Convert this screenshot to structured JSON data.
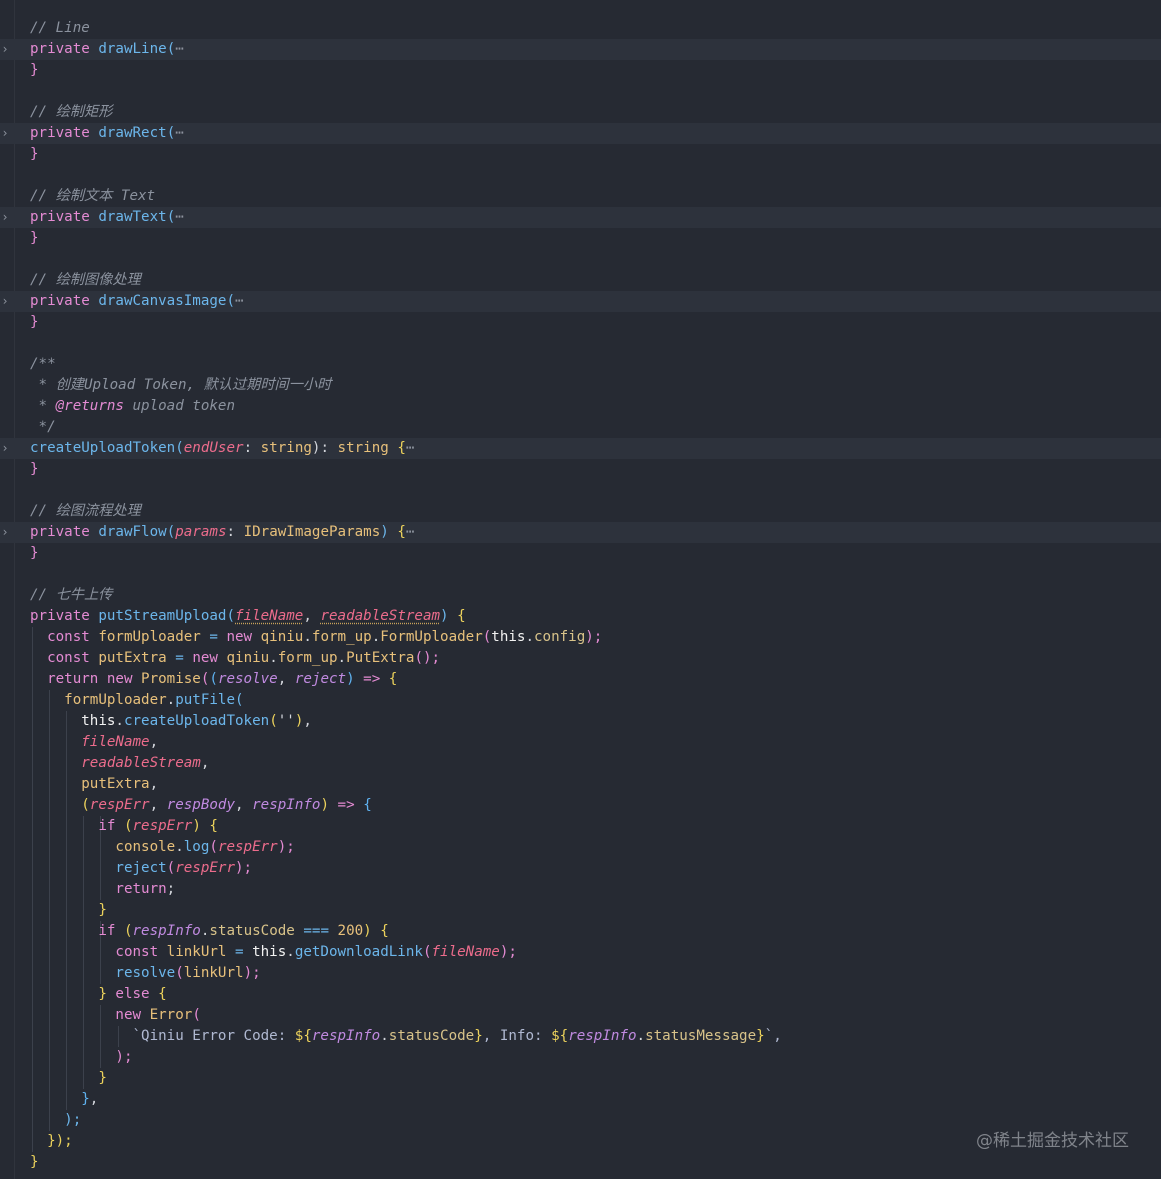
{
  "watermark": "@稀土掘金技术社区",
  "icons": {
    "fold": "chevron-right-icon",
    "ellipsis": "folded-ellipsis-icon"
  },
  "colors": {
    "background": "#262a33",
    "folded_line": "#2d323c",
    "comment": "#8b929e",
    "keyword": "#e48bd3",
    "function": "#6cb6eb",
    "parameter": "#ec6c8c",
    "type": "#e7c07b"
  },
  "code_lines": [
    {
      "folded": false,
      "tokens": [
        {
          "t": "// Line",
          "c": "cm"
        }
      ]
    },
    {
      "folded": true,
      "tokens": [
        {
          "t": "private ",
          "c": "kw"
        },
        {
          "t": "drawLine",
          "c": "fn"
        },
        {
          "t": "(",
          "c": "fn"
        },
        {
          "t": "⋯",
          "c": "ellipsis"
        }
      ]
    },
    {
      "folded": false,
      "tokens": [
        {
          "t": "}",
          "c": "b2"
        }
      ]
    },
    {
      "folded": false,
      "tokens": []
    },
    {
      "folded": false,
      "tokens": [
        {
          "t": "// 绘制矩形",
          "c": "cm"
        }
      ]
    },
    {
      "folded": true,
      "tokens": [
        {
          "t": "private ",
          "c": "kw"
        },
        {
          "t": "drawRect",
          "c": "fn"
        },
        {
          "t": "(",
          "c": "fn"
        },
        {
          "t": "⋯",
          "c": "ellipsis"
        }
      ]
    },
    {
      "folded": false,
      "tokens": [
        {
          "t": "}",
          "c": "b2"
        }
      ]
    },
    {
      "folded": false,
      "tokens": []
    },
    {
      "folded": false,
      "tokens": [
        {
          "t": "// 绘制文本 Text",
          "c": "cm"
        }
      ]
    },
    {
      "folded": true,
      "tokens": [
        {
          "t": "private ",
          "c": "kw"
        },
        {
          "t": "drawText",
          "c": "fn"
        },
        {
          "t": "(",
          "c": "fn"
        },
        {
          "t": "⋯",
          "c": "ellipsis"
        }
      ]
    },
    {
      "folded": false,
      "tokens": [
        {
          "t": "}",
          "c": "b2"
        }
      ]
    },
    {
      "folded": false,
      "tokens": []
    },
    {
      "folded": false,
      "tokens": [
        {
          "t": "// 绘制图像处理",
          "c": "cm"
        }
      ]
    },
    {
      "folded": true,
      "tokens": [
        {
          "t": "private ",
          "c": "kw"
        },
        {
          "t": "drawCanvasImage",
          "c": "fn"
        },
        {
          "t": "(",
          "c": "fn"
        },
        {
          "t": "⋯",
          "c": "ellipsis"
        }
      ]
    },
    {
      "folded": false,
      "tokens": [
        {
          "t": "}",
          "c": "b2"
        }
      ]
    },
    {
      "folded": false,
      "tokens": []
    },
    {
      "folded": false,
      "tokens": [
        {
          "t": "/**",
          "c": "cm"
        }
      ]
    },
    {
      "folded": false,
      "tokens": [
        {
          "t": " * 创建Upload Token, 默认过期时间一小时",
          "c": "cm"
        }
      ]
    },
    {
      "folded": false,
      "tokens": [
        {
          "t": " * ",
          "c": "cm"
        },
        {
          "t": "@returns",
          "c": "st"
        },
        {
          "t": " upload token",
          "c": "cm"
        }
      ]
    },
    {
      "folded": false,
      "tokens": [
        {
          "t": " */",
          "c": "cm"
        }
      ]
    },
    {
      "folded": true,
      "tokens": [
        {
          "t": "createUploadToken",
          "c": "fn"
        },
        {
          "t": "(",
          "c": "fn"
        },
        {
          "t": "endUser",
          "c": "pa"
        },
        {
          "t": ": ",
          "c": "tx"
        },
        {
          "t": "string",
          "c": "ty"
        },
        {
          "t": "): ",
          "c": "tx"
        },
        {
          "t": "string",
          "c": "ty"
        },
        {
          "t": " {",
          "c": "b1"
        },
        {
          "t": "⋯",
          "c": "ellipsis"
        }
      ]
    },
    {
      "folded": false,
      "tokens": [
        {
          "t": "}",
          "c": "b2"
        }
      ]
    },
    {
      "folded": false,
      "tokens": []
    },
    {
      "folded": false,
      "tokens": [
        {
          "t": "// 绘图流程处理",
          "c": "cm"
        }
      ]
    },
    {
      "folded": true,
      "tokens": [
        {
          "t": "private ",
          "c": "kw"
        },
        {
          "t": "drawFlow",
          "c": "fn"
        },
        {
          "t": "(",
          "c": "fn"
        },
        {
          "t": "params",
          "c": "pa"
        },
        {
          "t": ": ",
          "c": "tx"
        },
        {
          "t": "IDrawImageParams",
          "c": "ty"
        },
        {
          "t": ") ",
          "c": "fn"
        },
        {
          "t": "{",
          "c": "b1"
        },
        {
          "t": "⋯",
          "c": "ellipsis"
        }
      ]
    },
    {
      "folded": false,
      "tokens": [
        {
          "t": "}",
          "c": "b2"
        }
      ]
    },
    {
      "folded": false,
      "tokens": []
    },
    {
      "folded": false,
      "tokens": [
        {
          "t": "// 七牛上传",
          "c": "cm"
        }
      ]
    },
    {
      "folded": false,
      "tokens": [
        {
          "t": "private ",
          "c": "kw"
        },
        {
          "t": "putStreamUpload",
          "c": "fn"
        },
        {
          "t": "(",
          "c": "fn"
        },
        {
          "t": "fileName",
          "c": "pa squiggle"
        },
        {
          "t": ", ",
          "c": "tx"
        },
        {
          "t": "readableStream",
          "c": "pa squiggle"
        },
        {
          "t": ") ",
          "c": "fn"
        },
        {
          "t": "{",
          "c": "b1"
        }
      ]
    },
    {
      "folded": false,
      "tokens": [
        {
          "t": "  const ",
          "c": "kw"
        },
        {
          "t": "formUploader",
          "c": "ty"
        },
        {
          "t": " = ",
          "c": "op"
        },
        {
          "t": "new ",
          "c": "kw"
        },
        {
          "t": "qiniu",
          "c": "ty"
        },
        {
          "t": ".",
          "c": "tx"
        },
        {
          "t": "form_up",
          "c": "ty"
        },
        {
          "t": ".",
          "c": "tx"
        },
        {
          "t": "FormUploader",
          "c": "ty"
        },
        {
          "t": "(",
          "c": "b2"
        },
        {
          "t": "this",
          "c": "tl"
        },
        {
          "t": ".",
          "c": "tx"
        },
        {
          "t": "config",
          "c": "pr"
        },
        {
          "t": ");",
          "c": "b2"
        }
      ]
    },
    {
      "folded": false,
      "tokens": [
        {
          "t": "  const ",
          "c": "kw"
        },
        {
          "t": "putExtra",
          "c": "ty"
        },
        {
          "t": " = ",
          "c": "op"
        },
        {
          "t": "new ",
          "c": "kw"
        },
        {
          "t": "qiniu",
          "c": "ty"
        },
        {
          "t": ".",
          "c": "tx"
        },
        {
          "t": "form_up",
          "c": "ty"
        },
        {
          "t": ".",
          "c": "tx"
        },
        {
          "t": "PutExtra",
          "c": "ty"
        },
        {
          "t": "();",
          "c": "b2"
        }
      ]
    },
    {
      "folded": false,
      "tokens": [
        {
          "t": "  return ",
          "c": "kw"
        },
        {
          "t": "new ",
          "c": "kw"
        },
        {
          "t": "Promise",
          "c": "ty"
        },
        {
          "t": "(",
          "c": "b2"
        },
        {
          "t": "(",
          "c": "b3"
        },
        {
          "t": "resolve",
          "c": "pa2"
        },
        {
          "t": ", ",
          "c": "tx"
        },
        {
          "t": "reject",
          "c": "pa2"
        },
        {
          "t": ")",
          "c": "b3"
        },
        {
          "t": " => ",
          "c": "kw"
        },
        {
          "t": "{",
          "c": "b1"
        }
      ]
    },
    {
      "folded": false,
      "tokens": [
        {
          "t": "    formUploader",
          "c": "ty"
        },
        {
          "t": ".",
          "c": "tx"
        },
        {
          "t": "putFile",
          "c": "fn"
        },
        {
          "t": "(",
          "c": "fn"
        }
      ]
    },
    {
      "folded": false,
      "tokens": [
        {
          "t": "      this",
          "c": "tl"
        },
        {
          "t": ".",
          "c": "tx"
        },
        {
          "t": "createUploadToken",
          "c": "fn"
        },
        {
          "t": "(",
          "c": "b1"
        },
        {
          "t": "''",
          "c": "tx"
        },
        {
          "t": ")",
          "c": "b1"
        },
        {
          "t": ",",
          "c": "tx"
        }
      ]
    },
    {
      "folded": false,
      "tokens": [
        {
          "t": "      fileName",
          "c": "pa"
        },
        {
          "t": ",",
          "c": "tx"
        }
      ]
    },
    {
      "folded": false,
      "tokens": [
        {
          "t": "      readableStream",
          "c": "pa"
        },
        {
          "t": ",",
          "c": "tx"
        }
      ]
    },
    {
      "folded": false,
      "tokens": [
        {
          "t": "      putExtra",
          "c": "ty"
        },
        {
          "t": ",",
          "c": "tx"
        }
      ]
    },
    {
      "folded": false,
      "tokens": [
        {
          "t": "      (",
          "c": "b1"
        },
        {
          "t": "respErr",
          "c": "pa"
        },
        {
          "t": ", ",
          "c": "tx"
        },
        {
          "t": "respBody",
          "c": "pa2"
        },
        {
          "t": ", ",
          "c": "tx"
        },
        {
          "t": "respInfo",
          "c": "pa2"
        },
        {
          "t": ")",
          "c": "b1"
        },
        {
          "t": " => ",
          "c": "kw"
        },
        {
          "t": "{",
          "c": "b3"
        }
      ]
    },
    {
      "folded": false,
      "tokens": [
        {
          "t": "        if ",
          "c": "kw"
        },
        {
          "t": "(",
          "c": "b1"
        },
        {
          "t": "respErr",
          "c": "pa"
        },
        {
          "t": ") ",
          "c": "b1"
        },
        {
          "t": "{",
          "c": "b1"
        }
      ]
    },
    {
      "folded": false,
      "tokens": [
        {
          "t": "          console",
          "c": "ty"
        },
        {
          "t": ".",
          "c": "tx"
        },
        {
          "t": "log",
          "c": "fn"
        },
        {
          "t": "(",
          "c": "b2"
        },
        {
          "t": "respErr",
          "c": "pa"
        },
        {
          "t": ");",
          "c": "b2"
        }
      ]
    },
    {
      "folded": false,
      "tokens": [
        {
          "t": "          reject",
          "c": "fn"
        },
        {
          "t": "(",
          "c": "b2"
        },
        {
          "t": "respErr",
          "c": "pa"
        },
        {
          "t": ");",
          "c": "b2"
        }
      ]
    },
    {
      "folded": false,
      "tokens": [
        {
          "t": "          return",
          "c": "kw"
        },
        {
          "t": ";",
          "c": "tx"
        }
      ]
    },
    {
      "folded": false,
      "tokens": [
        {
          "t": "        }",
          "c": "b1"
        }
      ]
    },
    {
      "folded": false,
      "tokens": [
        {
          "t": "        if ",
          "c": "kw"
        },
        {
          "t": "(",
          "c": "b1"
        },
        {
          "t": "respInfo",
          "c": "pa2"
        },
        {
          "t": ".",
          "c": "tx"
        },
        {
          "t": "statusCode",
          "c": "pr"
        },
        {
          "t": " === ",
          "c": "op"
        },
        {
          "t": "200",
          "c": "nu"
        },
        {
          "t": ") ",
          "c": "b1"
        },
        {
          "t": "{",
          "c": "b1"
        }
      ]
    },
    {
      "folded": false,
      "tokens": [
        {
          "t": "          const ",
          "c": "kw"
        },
        {
          "t": "linkUrl",
          "c": "ty"
        },
        {
          "t": " = ",
          "c": "op"
        },
        {
          "t": "this",
          "c": "tl"
        },
        {
          "t": ".",
          "c": "tx"
        },
        {
          "t": "getDownloadLink",
          "c": "fn"
        },
        {
          "t": "(",
          "c": "b2"
        },
        {
          "t": "fileName",
          "c": "pa"
        },
        {
          "t": ");",
          "c": "b2"
        }
      ]
    },
    {
      "folded": false,
      "tokens": [
        {
          "t": "          resolve",
          "c": "fn"
        },
        {
          "t": "(",
          "c": "b2"
        },
        {
          "t": "linkUrl",
          "c": "ty"
        },
        {
          "t": ");",
          "c": "b2"
        }
      ]
    },
    {
      "folded": false,
      "tokens": [
        {
          "t": "        } ",
          "c": "b1"
        },
        {
          "t": "else ",
          "c": "kw"
        },
        {
          "t": "{",
          "c": "b1"
        }
      ]
    },
    {
      "folded": false,
      "tokens": [
        {
          "t": "          new ",
          "c": "kw"
        },
        {
          "t": "Error",
          "c": "ty"
        },
        {
          "t": "(",
          "c": "b2"
        }
      ]
    },
    {
      "folded": false,
      "tokens": [
        {
          "t": "            `Qiniu Error Code: ",
          "c": "tg"
        },
        {
          "t": "${",
          "c": "b1"
        },
        {
          "t": "respInfo",
          "c": "pa2"
        },
        {
          "t": ".",
          "c": "tx"
        },
        {
          "t": "statusCode",
          "c": "pr"
        },
        {
          "t": "}",
          "c": "b1"
        },
        {
          "t": ", Info: ",
          "c": "tg"
        },
        {
          "t": "${",
          "c": "b1"
        },
        {
          "t": "respInfo",
          "c": "pa2"
        },
        {
          "t": ".",
          "c": "tx"
        },
        {
          "t": "statusMessage",
          "c": "pr"
        },
        {
          "t": "}",
          "c": "b1"
        },
        {
          "t": "`,",
          "c": "tg"
        }
      ]
    },
    {
      "folded": false,
      "tokens": [
        {
          "t": "          );",
          "c": "b2"
        }
      ]
    },
    {
      "folded": false,
      "tokens": [
        {
          "t": "        }",
          "c": "b1"
        }
      ]
    },
    {
      "folded": false,
      "tokens": [
        {
          "t": "      }",
          "c": "b3"
        },
        {
          "t": ",",
          "c": "tx"
        }
      ]
    },
    {
      "folded": false,
      "tokens": [
        {
          "t": "    );",
          "c": "fn"
        }
      ]
    },
    {
      "folded": false,
      "tokens": [
        {
          "t": "  });",
          "c": "b1"
        }
      ]
    },
    {
      "folded": false,
      "tokens": [
        {
          "t": "}",
          "c": "b1"
        }
      ]
    }
  ]
}
